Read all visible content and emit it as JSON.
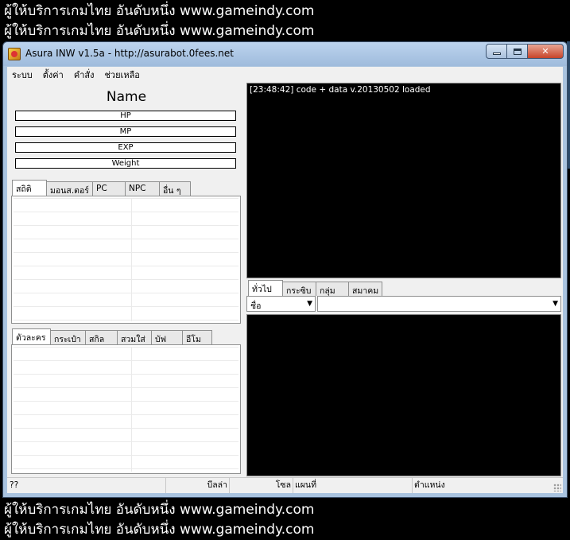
{
  "banner": {
    "line1": "ผู้ให้บริการเกมไทย อันดับหนึ่ง www.gameindy.com",
    "line2": "ผู้ให้บริการเกมไทย อันดับหนึ่ง www.gameindy.com",
    "line3": "ผู้ให้บริการเกมไทย อันดับหนึ่ง www.gameindy.com",
    "line4": "ผู้ให้บริการเกมไทย อันดับหนึ่ง www.gameindy.com"
  },
  "window": {
    "title": "Asura INW v1.5a - http://asurabot.0fees.net",
    "close_glyph": "✕"
  },
  "menu": [
    "ระบบ",
    "ตั้งค่า",
    "คำสั่ง",
    "ช่วยเหลือ"
  ],
  "character": {
    "name": "Name",
    "hp": "HP",
    "mp": "MP",
    "exp": "EXP",
    "weight": "Weight"
  },
  "top_tabs": [
    "สถิติ",
    "มอนส.ตอร์",
    "PC",
    "NPC",
    "อื่น ๆ"
  ],
  "bottom_tabs": [
    "ตัวละคร",
    "กระเป๋า",
    "สกิล",
    "สวมใส่",
    "บัฟ",
    "อีโม"
  ],
  "log": {
    "line": "[23:48:42] code + data v.20130502 loaded"
  },
  "chat_tabs": [
    "ทั่วไป",
    "กระซิบ",
    "กลุ่ม",
    "สมาคม"
  ],
  "chat": {
    "target_select": "ชื่อ",
    "message_select": "",
    "arrow": "▼"
  },
  "status": {
    "left": "??",
    "zeny": "บีลล่า",
    "zone": "โซล",
    "map": "แผนที่",
    "position": "ตำแหน่ง"
  }
}
